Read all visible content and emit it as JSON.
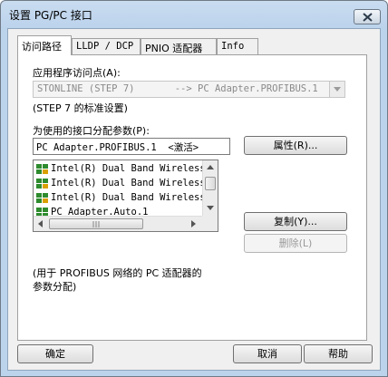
{
  "window": {
    "title": "设置 PG/PC 接口"
  },
  "tabs": [
    {
      "label": "访问路径"
    },
    {
      "label": "LLDP / DCP"
    },
    {
      "label": "PNIO 适配器"
    },
    {
      "label": "Info"
    }
  ],
  "access_point": {
    "label": "应用程序访问点(A):",
    "value": "STONLINE (STEP 7)       --> PC Adapter.PROFIBUS.1",
    "hint": "(STEP 7 的标准设置)"
  },
  "interface": {
    "label": "为使用的接口分配参数(P):",
    "value": "PC Adapter.PROFIBUS.1  <激活>",
    "properties_button": "属性(R)...",
    "copy_button": "复制(Y)...",
    "delete_button": "删除(L)",
    "items": [
      {
        "label": "Intel(R) Dual Band Wireless-"
      },
      {
        "label": "Intel(R) Dual Band Wireless-"
      },
      {
        "label": "Intel(R) Dual Band Wireless-"
      },
      {
        "label": "PC Adapter.Auto.1"
      }
    ],
    "description": "(用于 PROFIBUS 网络的 PC 适配器的\n参数分配)"
  },
  "footer": {
    "ok_button": "确定",
    "cancel_button": "取消",
    "help_button": "帮助"
  }
}
